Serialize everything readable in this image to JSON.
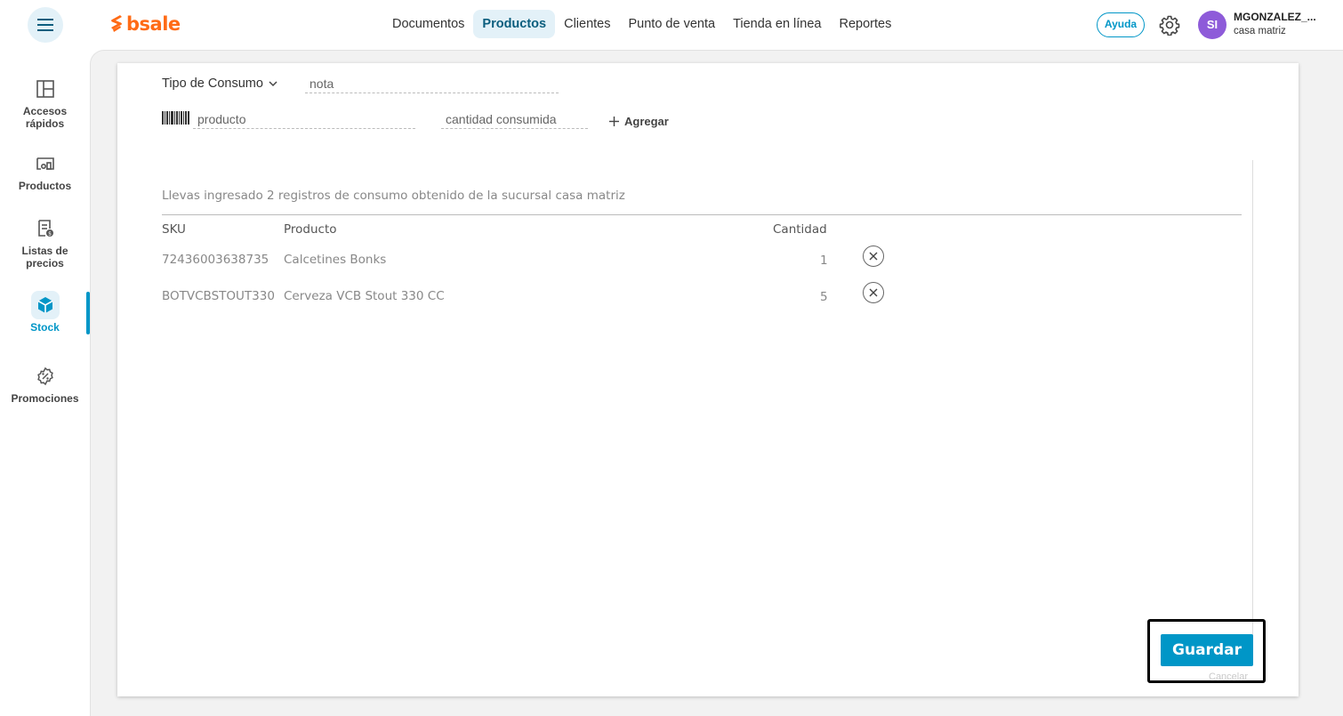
{
  "header": {
    "logo_text": "bsale",
    "nav": [
      {
        "label": "Documentos"
      },
      {
        "label": "Productos"
      },
      {
        "label": "Clientes"
      },
      {
        "label": "Punto de venta"
      },
      {
        "label": "Tienda en línea"
      },
      {
        "label": "Reportes"
      }
    ],
    "active_nav": "Productos",
    "help_label": "Ayuda",
    "avatar_initials": "SI",
    "user_name": "MGONZALEZ_...",
    "user_branch": "casa matriz"
  },
  "sidebar": {
    "items": [
      {
        "label": "Accesos rápidos",
        "icon": "layout-icon"
      },
      {
        "label": "Productos",
        "icon": "products-icon"
      },
      {
        "label": "Listas de precios",
        "icon": "price-list-icon"
      },
      {
        "label": "Stock",
        "icon": "box-icon"
      },
      {
        "label": "Promociones",
        "icon": "promo-icon"
      }
    ],
    "active": "Stock"
  },
  "form": {
    "tipo_consumo_label": "Tipo de Consumo",
    "nota_placeholder": "nota",
    "producto_placeholder": "producto",
    "cantidad_placeholder": "cantidad consumida",
    "agregar_label": "Agregar"
  },
  "summary_text": "Llevas ingresado 2 registros de consumo obtenido de la sucursal casa matriz",
  "table": {
    "headers": {
      "sku": "SKU",
      "producto": "Producto",
      "cantidad": "Cantidad"
    },
    "rows": [
      {
        "sku": "72436003638735",
        "producto": "Calcetines Bonks",
        "cantidad": "1"
      },
      {
        "sku": "BOTVCBSTOUT330",
        "producto": "Cerveza VCB Stout 330 CC",
        "cantidad": "5"
      }
    ]
  },
  "actions": {
    "save_label": "Guardar",
    "cancel_label": "Cancelar"
  },
  "colors": {
    "brand": "#ff6b16",
    "accent": "#0096c7",
    "avatar": "#8e5bd9"
  }
}
